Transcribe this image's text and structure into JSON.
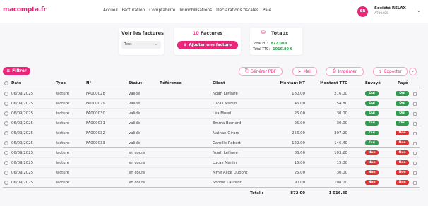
{
  "app": {
    "logo": "macompta.fr",
    "nav": [
      "Accueil",
      "Facturation",
      "Comptabilité",
      "Immobilisations",
      "Déclarations fiscales",
      "Paie"
    ],
    "company": {
      "initials": "SR",
      "name": "Société RELAX",
      "id": "AT00489"
    }
  },
  "cards": {
    "view": {
      "title": "Voir les factures",
      "select_value": "Tous"
    },
    "count": {
      "number": "10",
      "label": "Factures",
      "add_button": "Ajouter une facture"
    },
    "totals": {
      "title": "Totaux",
      "ht_label": "Total HT:",
      "ht_value": "872.00 €",
      "ttc_label": "Total TTC:",
      "ttc_value": "1016.80 €"
    }
  },
  "toolbar": {
    "filter": "Filtrer",
    "pdf": "Générer PDF",
    "mail": "Mail",
    "print": "Imprimer",
    "export": "Exporter"
  },
  "table": {
    "headers": {
      "date": "Date",
      "type": "Type",
      "num": "N°",
      "status": "Statut",
      "ref": "Référence",
      "client": "Client",
      "ht": "Montant HT",
      "ttc": "Montant TTC",
      "env": "Envoyé",
      "paye": "Payé"
    },
    "rows": [
      {
        "date": "06/09/2025",
        "type": "facture",
        "num": "FA000028",
        "status": "validé",
        "ref": "",
        "client": "Noah Lefèvre",
        "ht": "180.00",
        "ttc": "216.00",
        "env": "Oui",
        "paye": "Oui"
      },
      {
        "date": "06/09/2025",
        "type": "facture",
        "num": "FA000029",
        "status": "validé",
        "ref": "",
        "client": "Lucas Martin",
        "ht": "46.00",
        "ttc": "54.80",
        "env": "Oui",
        "paye": "Oui"
      },
      {
        "date": "06/09/2025",
        "type": "facture",
        "num": "FA000030",
        "status": "validé",
        "ref": "",
        "client": "Léa Morel",
        "ht": "25.00",
        "ttc": "30.00",
        "env": "Oui",
        "paye": "Oui"
      },
      {
        "date": "06/09/2025",
        "type": "facture",
        "num": "FA000031",
        "status": "validé",
        "ref": "",
        "client": "Emma Bernard",
        "ht": "25.00",
        "ttc": "30.00",
        "env": "Oui",
        "paye": "Oui"
      },
      {
        "date": "06/09/2025",
        "type": "facture",
        "num": "FA000032",
        "status": "validé",
        "ref": "",
        "client": "Nathan Girard",
        "ht": "256.00",
        "ttc": "307.20",
        "env": "Oui",
        "paye": "Non"
      },
      {
        "date": "06/09/2025",
        "type": "facture",
        "num": "FA000033",
        "status": "validé",
        "ref": "",
        "client": "Camille Robert",
        "ht": "122.00",
        "ttc": "146.40",
        "env": "Oui",
        "paye": "Non"
      },
      {
        "date": "06/09/2025",
        "type": "facture",
        "num": "",
        "status": "en cours",
        "ref": "",
        "client": "Noah Lefèvre",
        "ht": "86.00",
        "ttc": "103.20",
        "env": "Non",
        "paye": "Non"
      },
      {
        "date": "06/09/2025",
        "type": "facture",
        "num": "",
        "status": "en cours",
        "ref": "",
        "client": "Lucas Martin",
        "ht": "15.00",
        "ttc": "15.00",
        "env": "Non",
        "paye": "Non"
      },
      {
        "date": "06/09/2025",
        "type": "facture",
        "num": "",
        "status": "en cours",
        "ref": "",
        "client": "Mme Alice Dupont",
        "ht": "25.00",
        "ttc": "30.00",
        "env": "Non",
        "paye": "Non"
      },
      {
        "date": "06/09/2025",
        "type": "facture",
        "num": "",
        "status": "en cours",
        "ref": "",
        "client": "Sophie Laurent",
        "ht": "90.00",
        "ttc": "108.00",
        "env": "Non",
        "paye": "Non"
      }
    ],
    "total": {
      "label": "Total :",
      "ht": "872.00",
      "ttc": "1 016.80"
    }
  },
  "colors": {
    "accent": "#e8267a",
    "oui": "#2e9e4e",
    "non": "#e03131"
  }
}
